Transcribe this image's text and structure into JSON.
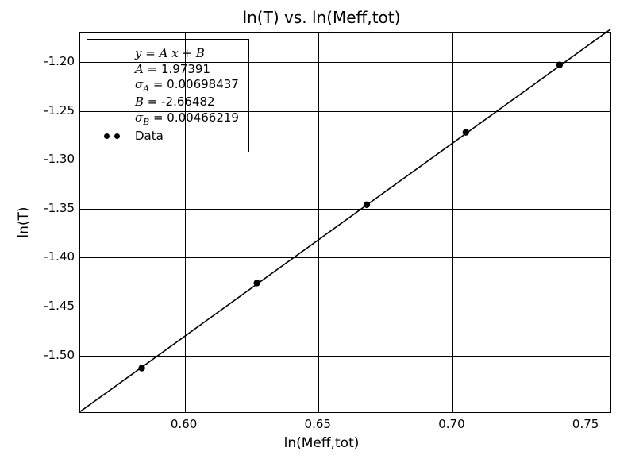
{
  "chart_data": {
    "type": "scatter",
    "title": "ln(T) vs. ln(Meff,tot)",
    "xlabel": "ln(Meff,tot)",
    "ylabel": "ln(T)",
    "xlim": [
      0.561,
      0.759
    ],
    "ylim": [
      -1.558,
      -1.17
    ],
    "xticks": [
      0.6,
      0.65,
      0.7,
      0.75
    ],
    "yticks": [
      -1.2,
      -1.25,
      -1.3,
      -1.35,
      -1.4,
      -1.45,
      -1.5
    ],
    "series": [
      {
        "name": "Fit line",
        "type": "line",
        "equation": {
          "form": "y = A x + B",
          "A": 1.97391,
          "B": -2.66482,
          "sigma_A": 0.00698437,
          "sigma_B": 0.00466219
        },
        "x": [
          0.561,
          0.759
        ],
        "y": [
          -1.55746,
          -1.16663
        ]
      },
      {
        "name": "Data",
        "type": "scatter",
        "x": [
          0.584,
          0.627,
          0.668,
          0.705,
          0.74
        ],
        "y": [
          -1.513,
          -1.426,
          -1.346,
          -1.272,
          -1.203
        ]
      }
    ],
    "legend": {
      "position": "upper left",
      "entries": [
        {
          "symbol": "line",
          "lines": [
            "y = A x + B",
            "A = 1.97391",
            "σ_A = 0.00698437",
            "B = -2.66482",
            "σ_B = 0.00466219"
          ]
        },
        {
          "symbol": "dots",
          "lines": [
            "Data"
          ]
        }
      ]
    }
  },
  "title": "ln(T) vs. ln(Meff,tot)",
  "xlabel": "ln(Meff,tot)",
  "ylabel": "ln(T)",
  "xticks": {
    "t0": "0.60",
    "t1": "0.65",
    "t2": "0.70",
    "t3": "0.75"
  },
  "yticks": {
    "t0": "-1.20",
    "t1": "-1.25",
    "t2": "-1.30",
    "t3": "-1.35",
    "t4": "-1.40",
    "t5": "-1.45",
    "t6": "-1.50"
  },
  "legend": {
    "eq_form_lhs": "y",
    "eq_form_eq": " = ",
    "eq_form_rhs_Ax": "A x",
    "eq_form_plus": " + ",
    "eq_form_B": "B",
    "A_label": "A",
    "A_val": " = 1.97391",
    "sigmaA_label": "σ",
    "sigmaA_sub": "A",
    "sigmaA_val": " = 0.00698437",
    "B_label": "B",
    "B_val": " = -2.66482",
    "sigmaB_label": "σ",
    "sigmaB_sub": "B",
    "sigmaB_val": " = 0.00466219",
    "data_label": "Data"
  }
}
